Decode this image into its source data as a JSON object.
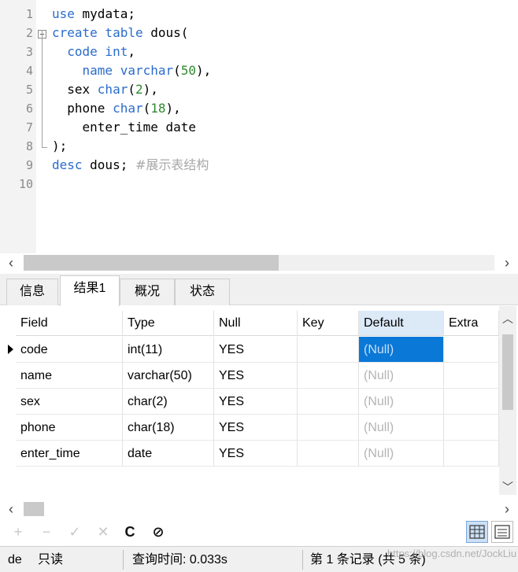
{
  "editor": {
    "line_numbers": [
      "1",
      "2",
      "3",
      "4",
      "5",
      "6",
      "7",
      "8",
      "9",
      "10"
    ],
    "lines": [
      [
        {
          "t": "use",
          "c": "kw"
        },
        {
          "t": " mydata;",
          "c": ""
        }
      ],
      [
        {
          "t": "create table",
          "c": "kw"
        },
        {
          "t": " dous(",
          "c": ""
        }
      ],
      [
        {
          "t": "  code int",
          "c": "kw"
        },
        {
          "t": ",",
          "c": ""
        }
      ],
      [
        {
          "t": "    name varchar",
          "c": "kw"
        },
        {
          "t": "(",
          "c": ""
        },
        {
          "t": "50",
          "c": "num"
        },
        {
          "t": "),",
          "c": ""
        }
      ],
      [
        {
          "t": "  sex ",
          "c": ""
        },
        {
          "t": "char",
          "c": "kw"
        },
        {
          "t": "(",
          "c": ""
        },
        {
          "t": "2",
          "c": "num"
        },
        {
          "t": "),",
          "c": ""
        }
      ],
      [
        {
          "t": "  phone ",
          "c": ""
        },
        {
          "t": "char",
          "c": "kw"
        },
        {
          "t": "(",
          "c": ""
        },
        {
          "t": "18",
          "c": "num"
        },
        {
          "t": "),",
          "c": ""
        }
      ],
      [
        {
          "t": "    enter_time date",
          "c": ""
        }
      ],
      [
        {
          "t": ");",
          "c": ""
        }
      ],
      [
        {
          "t": "desc",
          "c": "kw"
        },
        {
          "t": " dous; ",
          "c": ""
        },
        {
          "t": "#展示表结构",
          "c": "cm"
        }
      ],
      []
    ]
  },
  "tabs": [
    {
      "label": "信息",
      "active": false
    },
    {
      "label": "结果1",
      "active": true
    },
    {
      "label": "概况",
      "active": false
    },
    {
      "label": "状态",
      "active": false
    }
  ],
  "grid": {
    "columns": [
      "Field",
      "Type",
      "Null",
      "Key",
      "Default",
      "Extra"
    ],
    "rows": [
      [
        "code",
        "int(11)",
        "YES",
        "",
        "(Null)",
        ""
      ],
      [
        "name",
        "varchar(50)",
        "YES",
        "",
        "(Null)",
        ""
      ],
      [
        "sex",
        "char(2)",
        "YES",
        "",
        "(Null)",
        ""
      ],
      [
        "phone",
        "char(18)",
        "YES",
        "",
        "(Null)",
        ""
      ],
      [
        "enter_time",
        "date",
        "YES",
        "",
        "(Null)",
        ""
      ]
    ]
  },
  "toolbar": {
    "add": "+",
    "remove": "−",
    "apply": "✓",
    "discard": "✕",
    "refresh": "C",
    "stop": "⊘"
  },
  "status": {
    "mode": "de",
    "readonly": "只读",
    "query_time": "查询时间: 0.033s",
    "record": "第 1 条记录 (共 5 条)"
  },
  "watermark": "https://blog.csdn.net/JockLiu"
}
